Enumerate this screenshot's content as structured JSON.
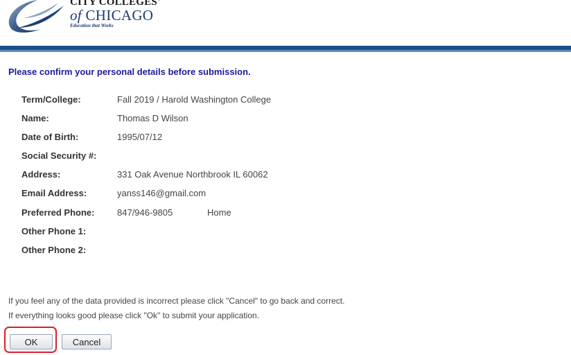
{
  "header": {
    "logo_line1": "CITY COLLEGES",
    "logo_reg": "®",
    "logo_of": "of",
    "logo_city": "CHICAGO",
    "logo_tagline": "Education that Works"
  },
  "heading": "Please confirm your personal details before submission.",
  "details": [
    {
      "label": "Term/College:",
      "value": "Fall 2019 / Harold Washington College"
    },
    {
      "label": "Name:",
      "value": "Thomas D Wilson"
    },
    {
      "label": "Date of Birth:",
      "value": "1995/07/12"
    },
    {
      "label": "Social Security #:",
      "value": ""
    },
    {
      "label": "Address:",
      "value": "331 Oak Avenue Northbrook IL 60062"
    },
    {
      "label": "Email Address:",
      "value": "yanss146@gmail.com"
    },
    {
      "label": "Preferred Phone:",
      "value": "847/946-9805",
      "type": "Home"
    },
    {
      "label": "Other Phone 1:",
      "value": ""
    },
    {
      "label": "Other Phone 2:",
      "value": ""
    }
  ],
  "notes": {
    "line1": "If you feel any of the data provided is incorrect please click \"Cancel\" to go back and correct.",
    "line2": "If everything looks good please click \"Ok\" to submit your application."
  },
  "buttons": {
    "ok_label": "OK",
    "cancel_label": "Cancel"
  },
  "colors": {
    "heading": "#1a1a9c",
    "header_bar": "#1e4f86",
    "highlight": "#dc1f26"
  }
}
